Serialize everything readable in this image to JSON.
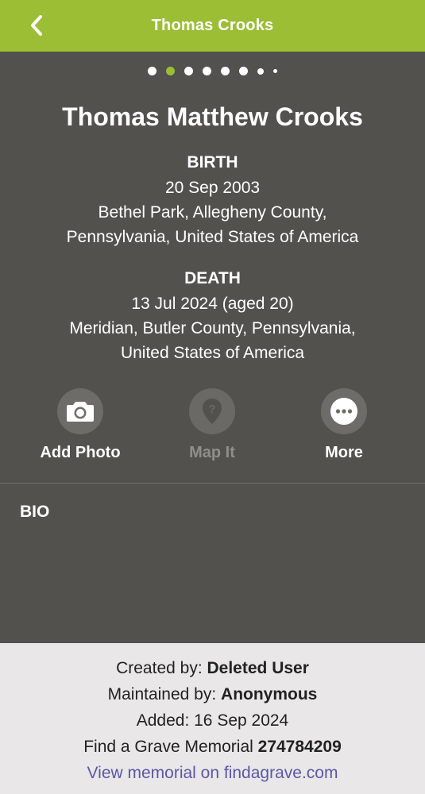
{
  "header": {
    "title": "Thomas Crooks",
    "back_icon": "chevron-left-icon",
    "background": "#9cbe34"
  },
  "pager": {
    "count": 8,
    "active_index": 1
  },
  "memorial": {
    "full_name": "Thomas Matthew Crooks",
    "birth": {
      "heading": "BIRTH",
      "date": "20 Sep 2003",
      "place_line1": "Bethel Park, Allegheny County,",
      "place_line2": "Pennsylvania, United States of America"
    },
    "death": {
      "heading": "DEATH",
      "date": "13 Jul 2024 (aged 20)",
      "place_line1": "Meridian, Butler County, Pennsylvania,",
      "place_line2": "United States of America"
    }
  },
  "actions": [
    {
      "label": "Add Photo",
      "icon": "camera-icon",
      "enabled": true
    },
    {
      "label": "Map It",
      "icon": "map-pin-icon",
      "enabled": false
    },
    {
      "label": "More",
      "icon": "more-icon",
      "enabled": true
    }
  ],
  "bio": {
    "heading": "BIO"
  },
  "footer": {
    "created_by_label": "Created by: ",
    "created_by_value": "Deleted User",
    "maintained_by_label": "Maintained by: ",
    "maintained_by_value": "Anonymous",
    "added": "Added: 16 Sep 2024",
    "memorial_label": "Find a Grave Memorial ",
    "memorial_id": "274784209",
    "link_text": "View memorial on findagrave.com"
  },
  "colors": {
    "accent": "#9cbe34",
    "panel": "#52514d",
    "footer_bg": "#e9e7e7",
    "link": "#5a57a8"
  }
}
